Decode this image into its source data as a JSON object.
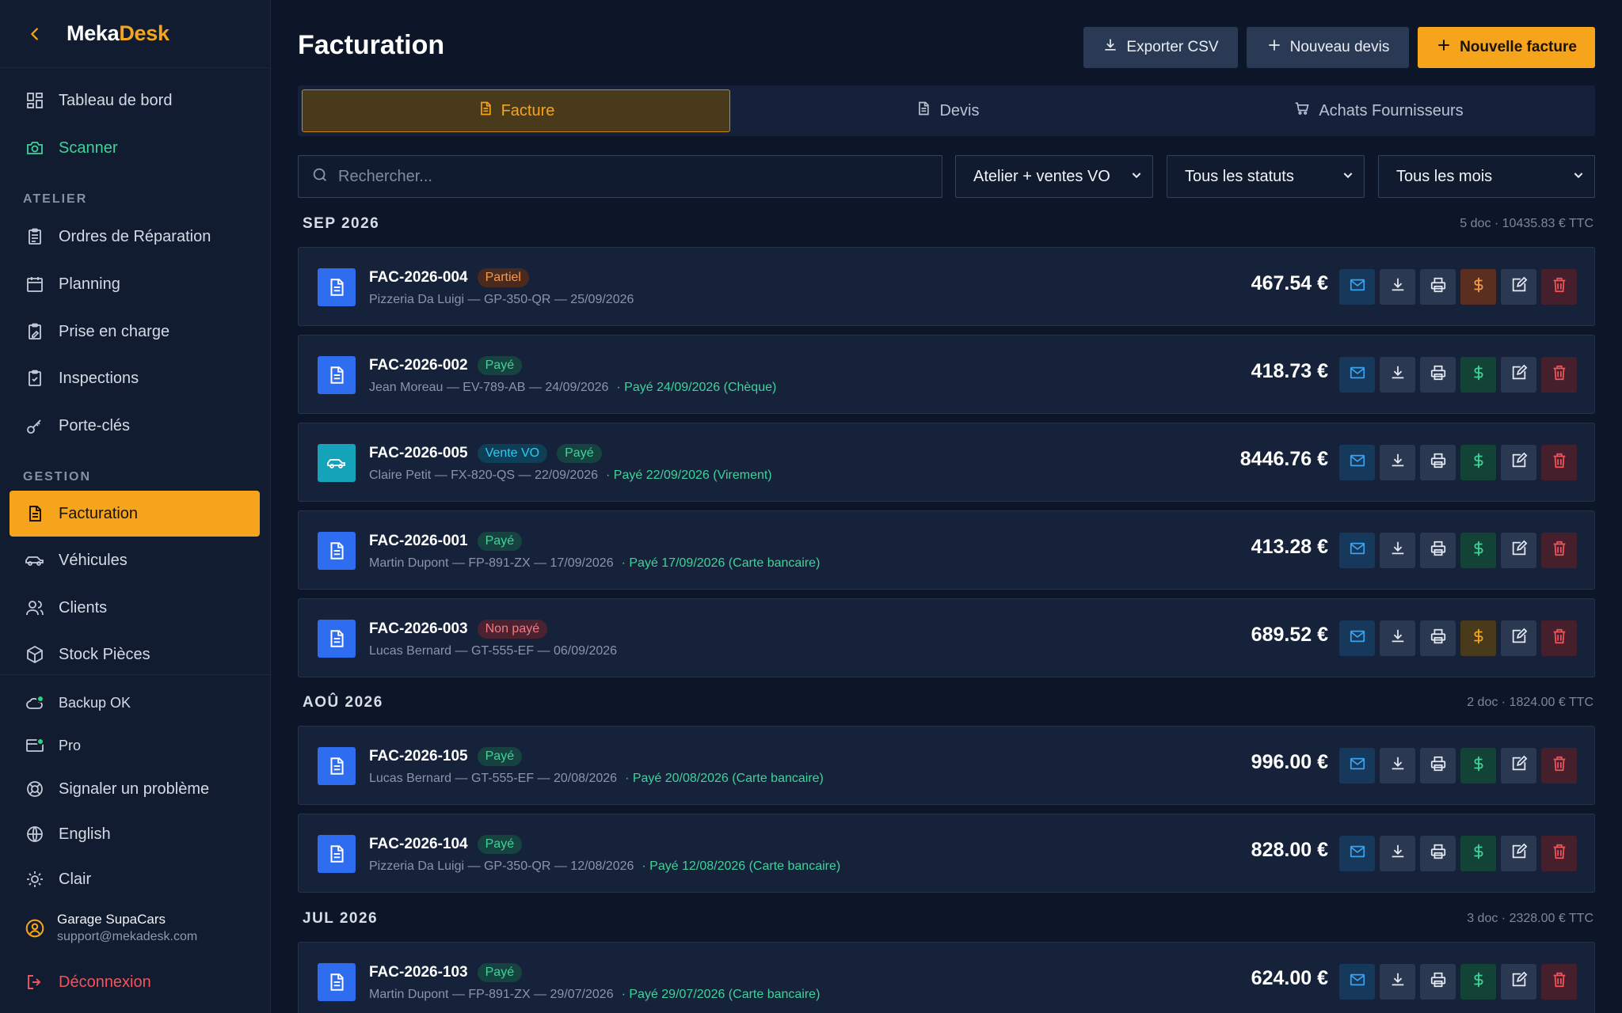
{
  "sidebar": {
    "brand": {
      "part1": "Meka",
      "part2": "Desk"
    },
    "items_top": [
      {
        "label": "Tableau de bord",
        "icon": "dashboard-icon"
      },
      {
        "label": "Scanner",
        "icon": "camera-icon"
      }
    ],
    "section_atelier": "ATELIER",
    "items_atelier": [
      {
        "label": "Ordres de Réparation",
        "icon": "clipboard-icon"
      },
      {
        "label": "Planning",
        "icon": "calendar-icon"
      },
      {
        "label": "Prise en charge",
        "icon": "clipboard-edit-icon"
      },
      {
        "label": "Inspections",
        "icon": "clipboard-check-icon"
      },
      {
        "label": "Porte-clés",
        "icon": "key-icon"
      }
    ],
    "section_gestion": "GESTION",
    "items_gestion": [
      {
        "label": "Facturation",
        "icon": "invoice-icon"
      },
      {
        "label": "Véhicules",
        "icon": "car-icon"
      },
      {
        "label": "Clients",
        "icon": "users-icon"
      },
      {
        "label": "Stock Pièces",
        "icon": "box-icon"
      }
    ],
    "backup": "Backup OK",
    "plan": "Pro",
    "report": "Signaler un problème",
    "language": "English",
    "theme": "Clair",
    "user_name": "Garage SupaCars",
    "user_email": "support@mekadesk.com",
    "logout": "Déconnexion"
  },
  "header": {
    "title": "Facturation",
    "export_label": "Exporter CSV",
    "new_quote_label": "Nouveau devis",
    "new_invoice_label": "Nouvelle facture"
  },
  "tabs": {
    "invoice": "Facture",
    "quote": "Devis",
    "purchases": "Achats Fournisseurs"
  },
  "filters": {
    "search_placeholder": "Rechercher...",
    "scope": "Atelier + ventes VO",
    "status": "Tous les statuts",
    "month": "Tous les mois"
  },
  "groups": [
    {
      "month": "SEP 2026",
      "summary": "5 doc · 10435.83 € TTC",
      "invoices": [
        {
          "number": "FAC-2026-004",
          "badges": [
            {
              "text": "Partiel",
              "kind": "partial"
            }
          ],
          "details": "Pizzeria Da Luigi — GP-350-QR — 25/09/2026",
          "payment": "",
          "amount": "467.54 €",
          "icon": "document-icon",
          "pay_state": "partial"
        },
        {
          "number": "FAC-2026-002",
          "badges": [
            {
              "text": "Payé",
              "kind": "paid"
            }
          ],
          "details": "Jean Moreau — EV-789-AB — 24/09/2026",
          "payment": "· Payé 24/09/2026 (Chèque)",
          "amount": "418.73 €",
          "icon": "document-icon",
          "pay_state": "paid"
        },
        {
          "number": "FAC-2026-005",
          "badges": [
            {
              "text": "Vente VO",
              "kind": "vo"
            },
            {
              "text": "Payé",
              "kind": "paid"
            }
          ],
          "details": "Claire Petit — FX-820-QS — 22/09/2026",
          "payment": "· Payé 22/09/2026 (Virement)",
          "amount": "8446.76 €",
          "icon": "car-icon",
          "pay_state": "paid"
        },
        {
          "number": "FAC-2026-001",
          "badges": [
            {
              "text": "Payé",
              "kind": "paid"
            }
          ],
          "details": "Martin Dupont — FP-891-ZX — 17/09/2026",
          "payment": "· Payé 17/09/2026 (Carte bancaire)",
          "amount": "413.28 €",
          "icon": "document-icon",
          "pay_state": "paid"
        },
        {
          "number": "FAC-2026-003",
          "badges": [
            {
              "text": "Non payé",
              "kind": "unpaid"
            }
          ],
          "details": "Lucas Bernard — GT-555-EF — 06/09/2026",
          "payment": "",
          "amount": "689.52 €",
          "icon": "document-icon",
          "pay_state": "unpaid"
        }
      ]
    },
    {
      "month": "AOÛ 2026",
      "summary": "2 doc · 1824.00 € TTC",
      "invoices": [
        {
          "number": "FAC-2026-105",
          "badges": [
            {
              "text": "Payé",
              "kind": "paid"
            }
          ],
          "details": "Lucas Bernard — GT-555-EF — 20/08/2026",
          "payment": "· Payé 20/08/2026 (Carte bancaire)",
          "amount": "996.00 €",
          "icon": "document-icon",
          "pay_state": "paid"
        },
        {
          "number": "FAC-2026-104",
          "badges": [
            {
              "text": "Payé",
              "kind": "paid"
            }
          ],
          "details": "Pizzeria Da Luigi — GP-350-QR — 12/08/2026",
          "payment": "· Payé 12/08/2026 (Carte bancaire)",
          "amount": "828.00 €",
          "icon": "document-icon",
          "pay_state": "paid"
        }
      ]
    },
    {
      "month": "JUL 2026",
      "summary": "3 doc · 2328.00 € TTC",
      "invoices": [
        {
          "number": "FAC-2026-103",
          "badges": [
            {
              "text": "Payé",
              "kind": "paid"
            }
          ],
          "details": "Martin Dupont — FP-891-ZX — 29/07/2026",
          "payment": "· Payé 29/07/2026 (Carte bancaire)",
          "amount": "624.00 €",
          "icon": "document-icon",
          "pay_state": "paid"
        }
      ]
    }
  ],
  "colors": {
    "accent": "#f5a41b",
    "background": "#0d1628",
    "sidebar": "#111c30",
    "paid": "#3ed39a",
    "unpaid": "#f27b84",
    "partial": "#f59a4b",
    "vo": "#35c7f0",
    "danger": "#f2545b"
  }
}
